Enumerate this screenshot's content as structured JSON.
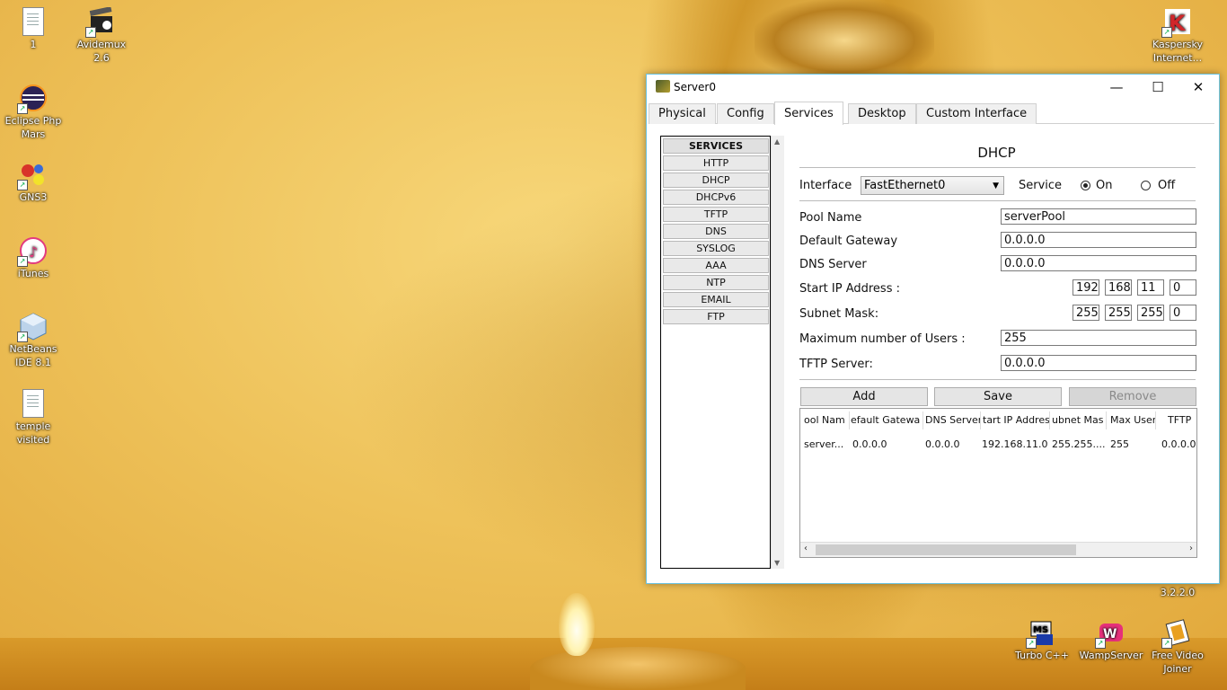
{
  "desktop": {
    "icons_left": [
      {
        "label": "1"
      },
      {
        "label": "Eclipse Php Mars"
      },
      {
        "label": "GNS3"
      },
      {
        "label": "iTunes"
      },
      {
        "label": "NetBeans IDE 8.1"
      },
      {
        "label": "temple visited"
      }
    ],
    "avidemux": {
      "label": "Avidemux 2.6"
    },
    "kaspersky": {
      "label": "Kaspersky Internet..."
    },
    "version_text": "3.2.2.0",
    "bottom_icons": [
      {
        "label": "Turbo C++"
      },
      {
        "label": "WampServer"
      },
      {
        "label": "Free Video Joiner"
      }
    ]
  },
  "window": {
    "title": "Server0",
    "minimize": "—",
    "maximize": "☐",
    "close": "✕",
    "tabs": [
      {
        "label": "Physical"
      },
      {
        "label": "Config"
      },
      {
        "label": "Services"
      },
      {
        "label": "Desktop"
      },
      {
        "label": "Custom Interface"
      }
    ],
    "active_tab": "Services"
  },
  "services": {
    "header": "SERVICES",
    "items": [
      "HTTP",
      "DHCP",
      "DHCPv6",
      "TFTP",
      "DNS",
      "SYSLOG",
      "AAA",
      "NTP",
      "EMAIL",
      "FTP"
    ]
  },
  "dhcp": {
    "title": "DHCP",
    "interface_label": "Interface",
    "interface_value": "FastEthernet0",
    "service_label": "Service",
    "on_label": "On",
    "off_label": "Off",
    "service_state": "On",
    "pool_name_label": "Pool Name",
    "pool_name": "serverPool",
    "gateway_label": "Default Gateway",
    "gateway": "0.0.0.0",
    "dns_label": "DNS Server",
    "dns": "0.0.0.0",
    "start_ip_label": "Start IP Address :",
    "start_ip": [
      "192",
      "168",
      "11",
      "0"
    ],
    "subnet_label": "Subnet Mask:",
    "subnet": [
      "255",
      "255",
      "255",
      "0"
    ],
    "max_users_label": "Maximum number of Users :",
    "max_users": "255",
    "tftp_label": "TFTP Server:",
    "tftp": "0.0.0.0",
    "add_label": "Add",
    "save_label": "Save",
    "remove_label": "Remove",
    "table": {
      "headers": [
        "ool Nam",
        "efault Gatewa",
        "DNS Server",
        "tart IP Addres",
        "ubnet Mas",
        "Max User",
        "TFTP"
      ],
      "row": [
        "server...",
        "0.0.0.0",
        "0.0.0.0",
        "192.168.11.0",
        "255.255....",
        "255",
        "0.0.0.0"
      ]
    }
  }
}
